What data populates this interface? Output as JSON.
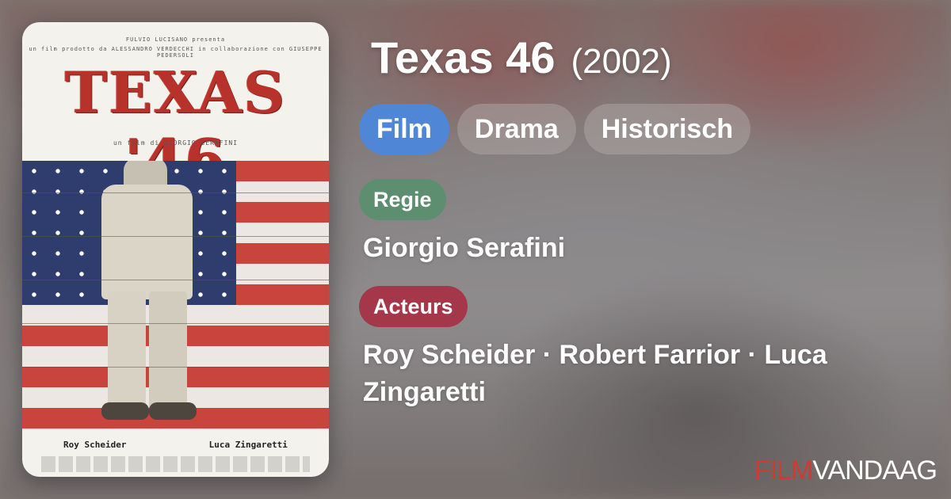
{
  "poster": {
    "title": "TEXAS '46",
    "credits_top": "FULVIO LUCISANO presenta",
    "credits_top2": "un film prodotto da ALESSANDRO VERDECCHI   in collaborazione con GIUSEPPE PEDERSOLI",
    "director_credit": "un film di GIORGIO SERAFINI",
    "actors": [
      "Roy Scheider",
      "Luca Zingaretti"
    ]
  },
  "movie": {
    "title": "Texas 46",
    "year": "(2002)"
  },
  "genres": [
    "Film",
    "Drama",
    "Historisch"
  ],
  "regie": {
    "label": "Regie",
    "name": "Giorgio Serafini"
  },
  "acteurs": {
    "label": "Acteurs",
    "names": "Roy Scheider · Robert Farrior · Luca Zingaretti"
  },
  "brand": {
    "part1": "FILM",
    "part2": "VANDAAG"
  },
  "colors": {
    "film_chip": "#4f86d6",
    "regie_tag": "#5c8e6f",
    "acteurs_tag": "#a5374a",
    "brand_red": "#cf3a33"
  }
}
